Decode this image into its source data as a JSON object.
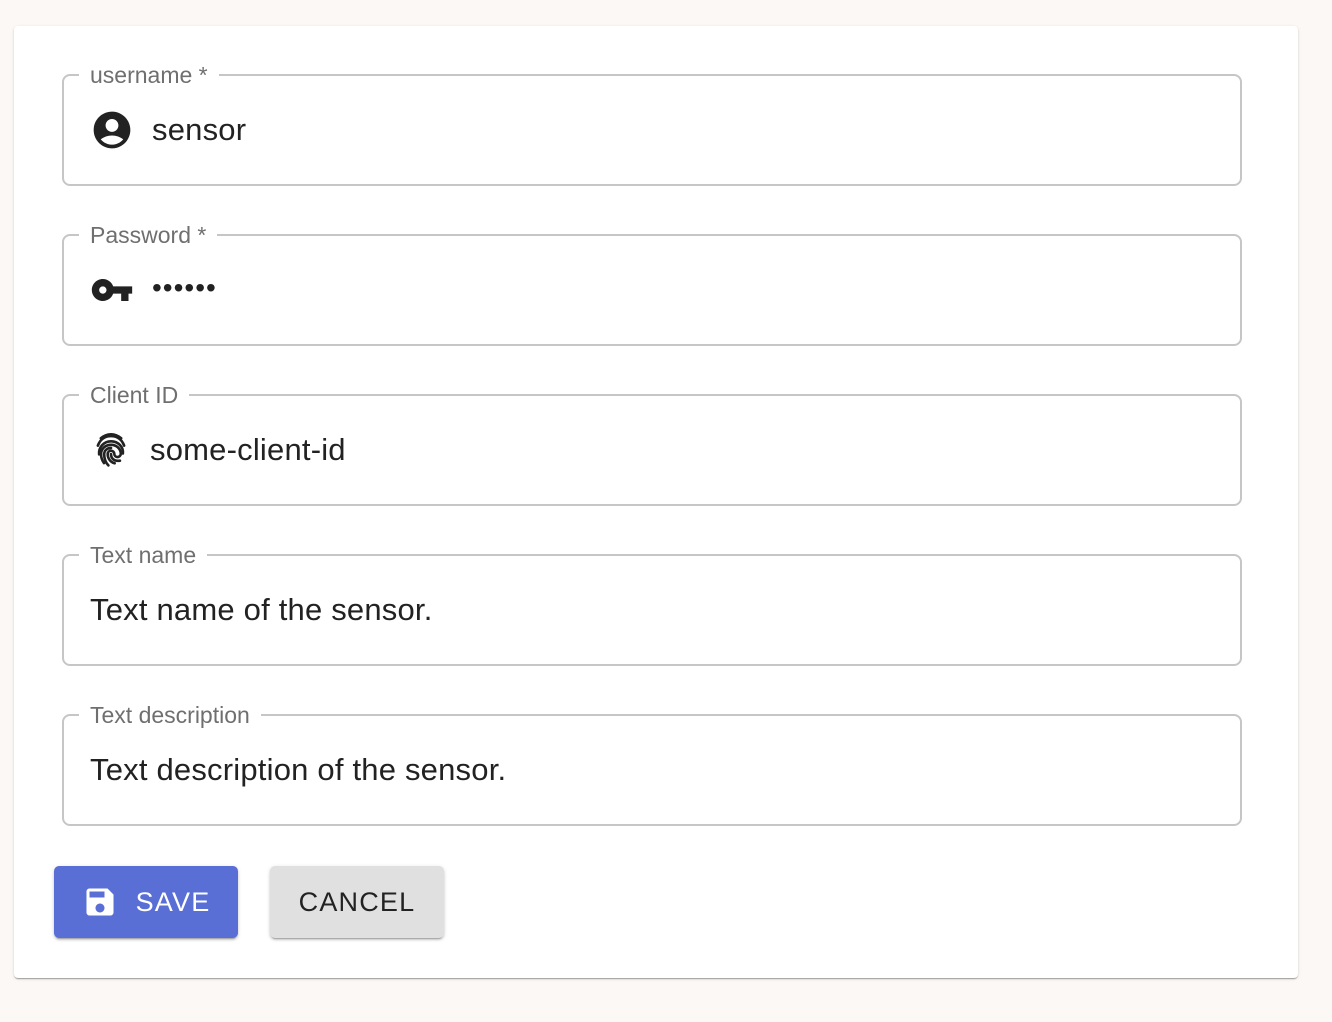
{
  "form": {
    "fields": [
      {
        "label": "username *",
        "value": "sensor",
        "icon": "account-circle-icon"
      },
      {
        "label": "Password *",
        "value": "••••••",
        "icon": "key-icon"
      },
      {
        "label": "Client ID",
        "value": "some-client-id",
        "icon": "fingerprint-icon"
      },
      {
        "label": "Text name",
        "value": "Text name of the sensor."
      },
      {
        "label": "Text description",
        "value": "Text description of the sensor."
      }
    ],
    "save_label": "SAVE",
    "save_icon": "floppy-disk-icon",
    "cancel_label": "CANCEL"
  },
  "colors": {
    "primary": "#5a6fd6",
    "cancel_bg": "#e0e0e0",
    "page_bg": "#fcf8f6"
  }
}
